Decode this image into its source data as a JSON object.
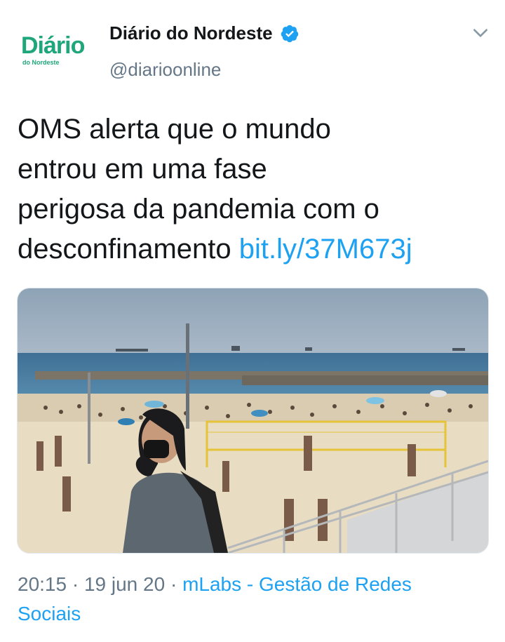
{
  "author": {
    "name": "Diário do Nordeste",
    "handle": "@diarioonline",
    "avatar_logo": "Diário",
    "avatar_sub": "do Nordeste"
  },
  "icons": {
    "verified": "verified-badge-icon",
    "menu": "chevron-down-icon"
  },
  "tweet": {
    "lines": [
      "OMS alerta que o mundo",
      "entrou em uma fase",
      "perigosa da pandemia com o",
      "desconfinamento"
    ],
    "link": "bit.ly/37M673j"
  },
  "meta": {
    "time": "20:15",
    "date": "19 jun 20",
    "separator": " · ",
    "source_line1": "mLabs - Gestão de Redes",
    "source_line2": "Sociais"
  },
  "colors": {
    "link": "#1da1f2",
    "secondary_text": "#657786",
    "brand_green": "#1fa67a"
  }
}
